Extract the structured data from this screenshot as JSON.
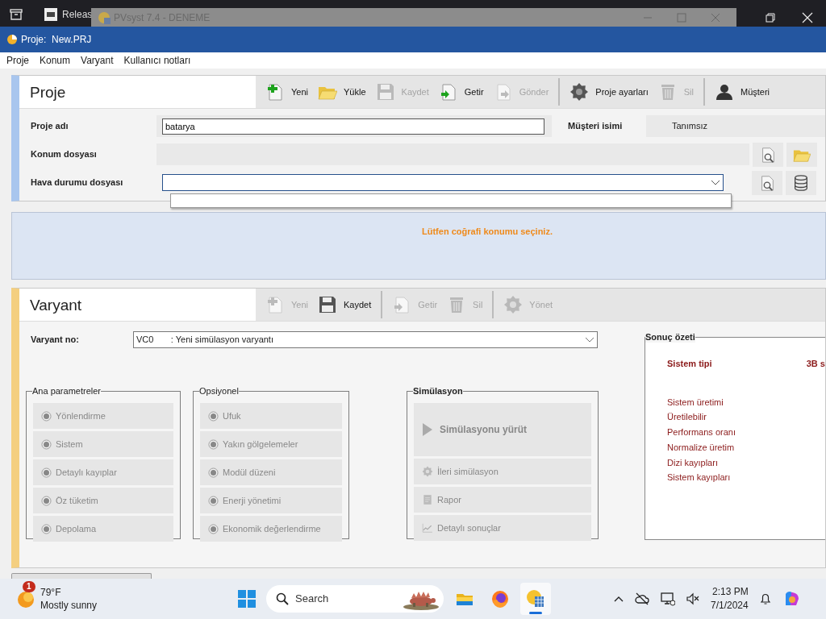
{
  "desktop_bar": {
    "app_label": "Releas",
    "ghost_window": {
      "title": "PVsyst 7.4 - DENEME"
    }
  },
  "window": {
    "title": "Proje:  New.PRJ"
  },
  "menu": [
    {
      "label": "Proje"
    },
    {
      "label": "Konum"
    },
    {
      "label": "Varyant"
    },
    {
      "label": "Kullanıcı notları"
    }
  ],
  "project": {
    "title": "Proje",
    "toolbar": [
      {
        "kind": "new",
        "label": "Yeni",
        "disabled": false
      },
      {
        "kind": "folder",
        "label": "Yükle",
        "disabled": false
      },
      {
        "kind": "save",
        "label": "Kaydet",
        "disabled": true
      },
      {
        "kind": "import",
        "label": "Getir",
        "disabled": false
      },
      {
        "kind": "export",
        "label": "Gönder",
        "disabled": true
      },
      {
        "kind": "separator"
      },
      {
        "kind": "gear",
        "label": "Proje ayarları",
        "disabled": false
      },
      {
        "kind": "trash",
        "label": "Sil",
        "disabled": true
      },
      {
        "kind": "separator"
      },
      {
        "kind": "person",
        "label": "Müşteri",
        "disabled": false
      }
    ],
    "name_field": {
      "label": "Proje adı",
      "value": "batarya"
    },
    "customer": {
      "label": "Müşteri isimi",
      "value": "Tanımsız"
    },
    "location_file": {
      "label": "Konum dosyası"
    },
    "weather_file": {
      "label": "Hava durumu dosyası",
      "expanded": true
    }
  },
  "notice": {
    "text": "Lütfen coğrafi konumu seçiniz."
  },
  "variant": {
    "title": "Varyant",
    "toolbar": [
      {
        "kind": "new",
        "label": "Yeni",
        "disabled": true
      },
      {
        "kind": "save",
        "label": "Kaydet",
        "disabled": false
      },
      {
        "kind": "separator"
      },
      {
        "kind": "import",
        "label": "Getir",
        "disabled": true
      },
      {
        "kind": "trash",
        "label": "Sil",
        "disabled": true
      },
      {
        "kind": "separator"
      },
      {
        "kind": "gear",
        "label": "Yönet",
        "disabled": true
      }
    ],
    "variant_no": {
      "label": "Varyant no:",
      "value": "VC0       : Yeni simülasyon varyantı"
    },
    "groups": [
      {
        "title": "Ana parametreler",
        "items": [
          {
            "label": "Yönlendirme",
            "disabled": true
          },
          {
            "label": "Sistem",
            "disabled": true
          },
          {
            "label": "Detaylı kayıplar",
            "disabled": true
          },
          {
            "label": "Öz tüketim",
            "disabled": true
          },
          {
            "label": "Depolama",
            "disabled": true
          }
        ]
      },
      {
        "title": "Opsiyonel",
        "items": [
          {
            "label": "Ufuk",
            "disabled": true
          },
          {
            "label": "Yakın gölgelemeler",
            "disabled": true
          },
          {
            "label": "Modül düzeni",
            "disabled": true
          },
          {
            "label": "Enerji yönetimi",
            "disabled": true
          },
          {
            "label": "Ekonomik değerlendirme",
            "disabled": true
          }
        ]
      }
    ],
    "simulation": {
      "title": "Simülasyon",
      "run": {
        "label": "Simülasyonu yürüt",
        "disabled": true
      },
      "actions": [
        {
          "label": "İleri simülasyon",
          "kind": "gear",
          "disabled": true
        },
        {
          "label": "Rapor",
          "kind": "report",
          "disabled": true
        },
        {
          "label": "Detaylı sonuçlar",
          "kind": "chart",
          "disabled": true
        }
      ]
    },
    "summary": {
      "title": "Sonuç özeti",
      "system_type": {
        "label": "Sistem tipi",
        "value": "3B s"
      },
      "items": [
        "Sistem üretimi",
        "Üretilebilir",
        "Performans oranı",
        "Normalize üretim",
        "Dizi kayıpları",
        "Sistem kayıpları"
      ]
    }
  },
  "taskbar": {
    "weather": {
      "badge": "1",
      "temperature": "79°F",
      "condition": "Mostly sunny"
    },
    "search": {
      "placeholder": "Search"
    },
    "apps": [
      {
        "kind": "explorer",
        "selected": false
      },
      {
        "kind": "firefox",
        "selected": false
      },
      {
        "kind": "pvsyst",
        "selected": true
      }
    ],
    "time": "2:13 PM",
    "date": "7/1/2024"
  }
}
